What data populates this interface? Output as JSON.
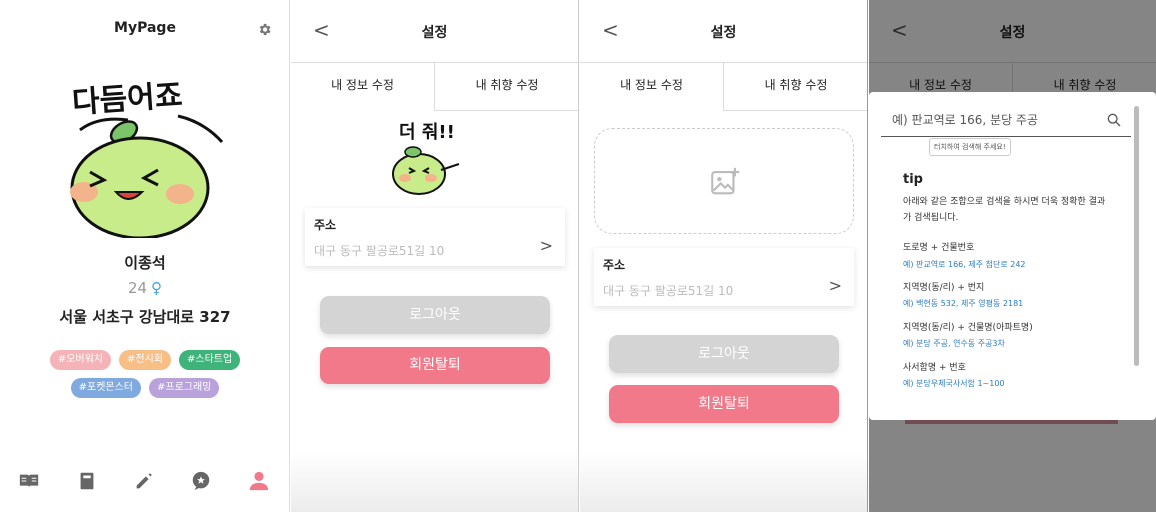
{
  "mypage": {
    "title": "MyPage",
    "sticker_text": "다듬어죠",
    "name": "이종석",
    "age": "24",
    "gender_symbol": "♀",
    "address": "서울 서초구 강남대로 327",
    "tags": [
      {
        "label": "#오버워치",
        "color": "#f5b3b8"
      },
      {
        "label": "#전시회",
        "color": "#f7be86"
      },
      {
        "label": "#스타트업",
        "color": "#3fb47a"
      },
      {
        "label": "#포켓몬스터",
        "color": "#7fa9df"
      },
      {
        "label": "#프로그래밍",
        "color": "#b9a2dc"
      }
    ],
    "nav_icons": [
      "book-open-icon",
      "book-icon",
      "pencil-icon",
      "chat-icon",
      "person-icon"
    ],
    "nav_active": "person-icon",
    "active_color": "#f27989"
  },
  "settings": {
    "back_symbol": "<",
    "title": "설정",
    "tab_info": "내 정보 수정",
    "tab_pref": "내 취향 수정",
    "sticker_text": "더 줘!!",
    "address_label": "주소",
    "address_value": "대구 동구 팔공로51길 10",
    "arrow_symbol": ">",
    "logout": "로그아웃",
    "withdraw": "회원탈퇴"
  },
  "search_modal": {
    "placeholder": "예) 판교역로 166, 분당 주공",
    "tooltip": "터치하여 검색해 주세요!",
    "tip_title": "tip",
    "tip_body": "아래와 같은 조합으로 검색을 하시면 더욱 정확한 결과가 검색됩니다.",
    "rows": [
      {
        "heading": "도로명 + 건물번호",
        "example": "예) 판교역로 166,  제주 첨단로 242"
      },
      {
        "heading": "지역명(동/리) + 번지",
        "example": "예) 백현동 532,  제주 영평동 2181"
      },
      {
        "heading": "지역명(동/리) + 건물명(아파트명)",
        "example": "예) 분당 주공,  연수동 주공3차"
      },
      {
        "heading": "사서함명 + 번호",
        "example": "예) 분당우체국사서함 1~100"
      }
    ]
  }
}
